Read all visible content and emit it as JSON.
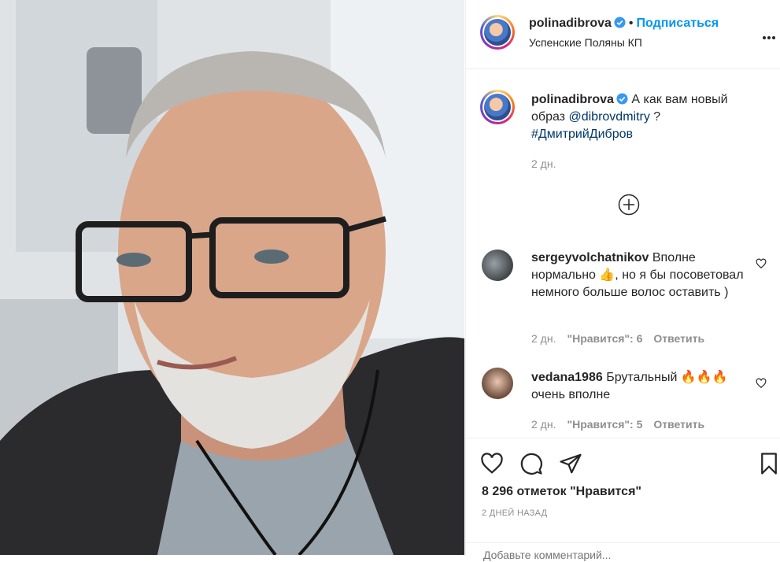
{
  "photo": {
    "alt": ""
  },
  "header": {
    "username": "polinadibrova",
    "dot": "•",
    "follow_label": "Подписаться",
    "location": "Успенские Поляны КП",
    "more_icon": "more-options-icon"
  },
  "caption": {
    "username": "polinadibrova",
    "text_before": "А как вам новый образ ",
    "mention": "@dibrovdmitry",
    "text_after": " ?",
    "hashtag": "#ДмитрийДибров",
    "time": "2 дн."
  },
  "comments": [
    {
      "username": "sergeyvolchatnikov",
      "text": "Вполне нормально 👍, но я бы посоветовал немного больше волос оставить )",
      "time": "2 дн.",
      "likes": "\"Нравится\": 6",
      "reply": "Ответить"
    },
    {
      "username": "vedana1986",
      "text": "Брутальный 🔥🔥🔥 очень вполне",
      "time": "2 дн.",
      "likes": "\"Нравится\": 5",
      "reply": "Ответить"
    }
  ],
  "actions": {
    "likes_count": "8 296 отметок \"Нравится\"",
    "posted_ago": "2 ДНЕЙ НАЗАД"
  },
  "add_comment_placeholder": "Добавьте комментарий...",
  "colors": {
    "accent": "#0095f6",
    "text": "#262626",
    "muted": "#8e8e8e",
    "link": "#00376b"
  }
}
